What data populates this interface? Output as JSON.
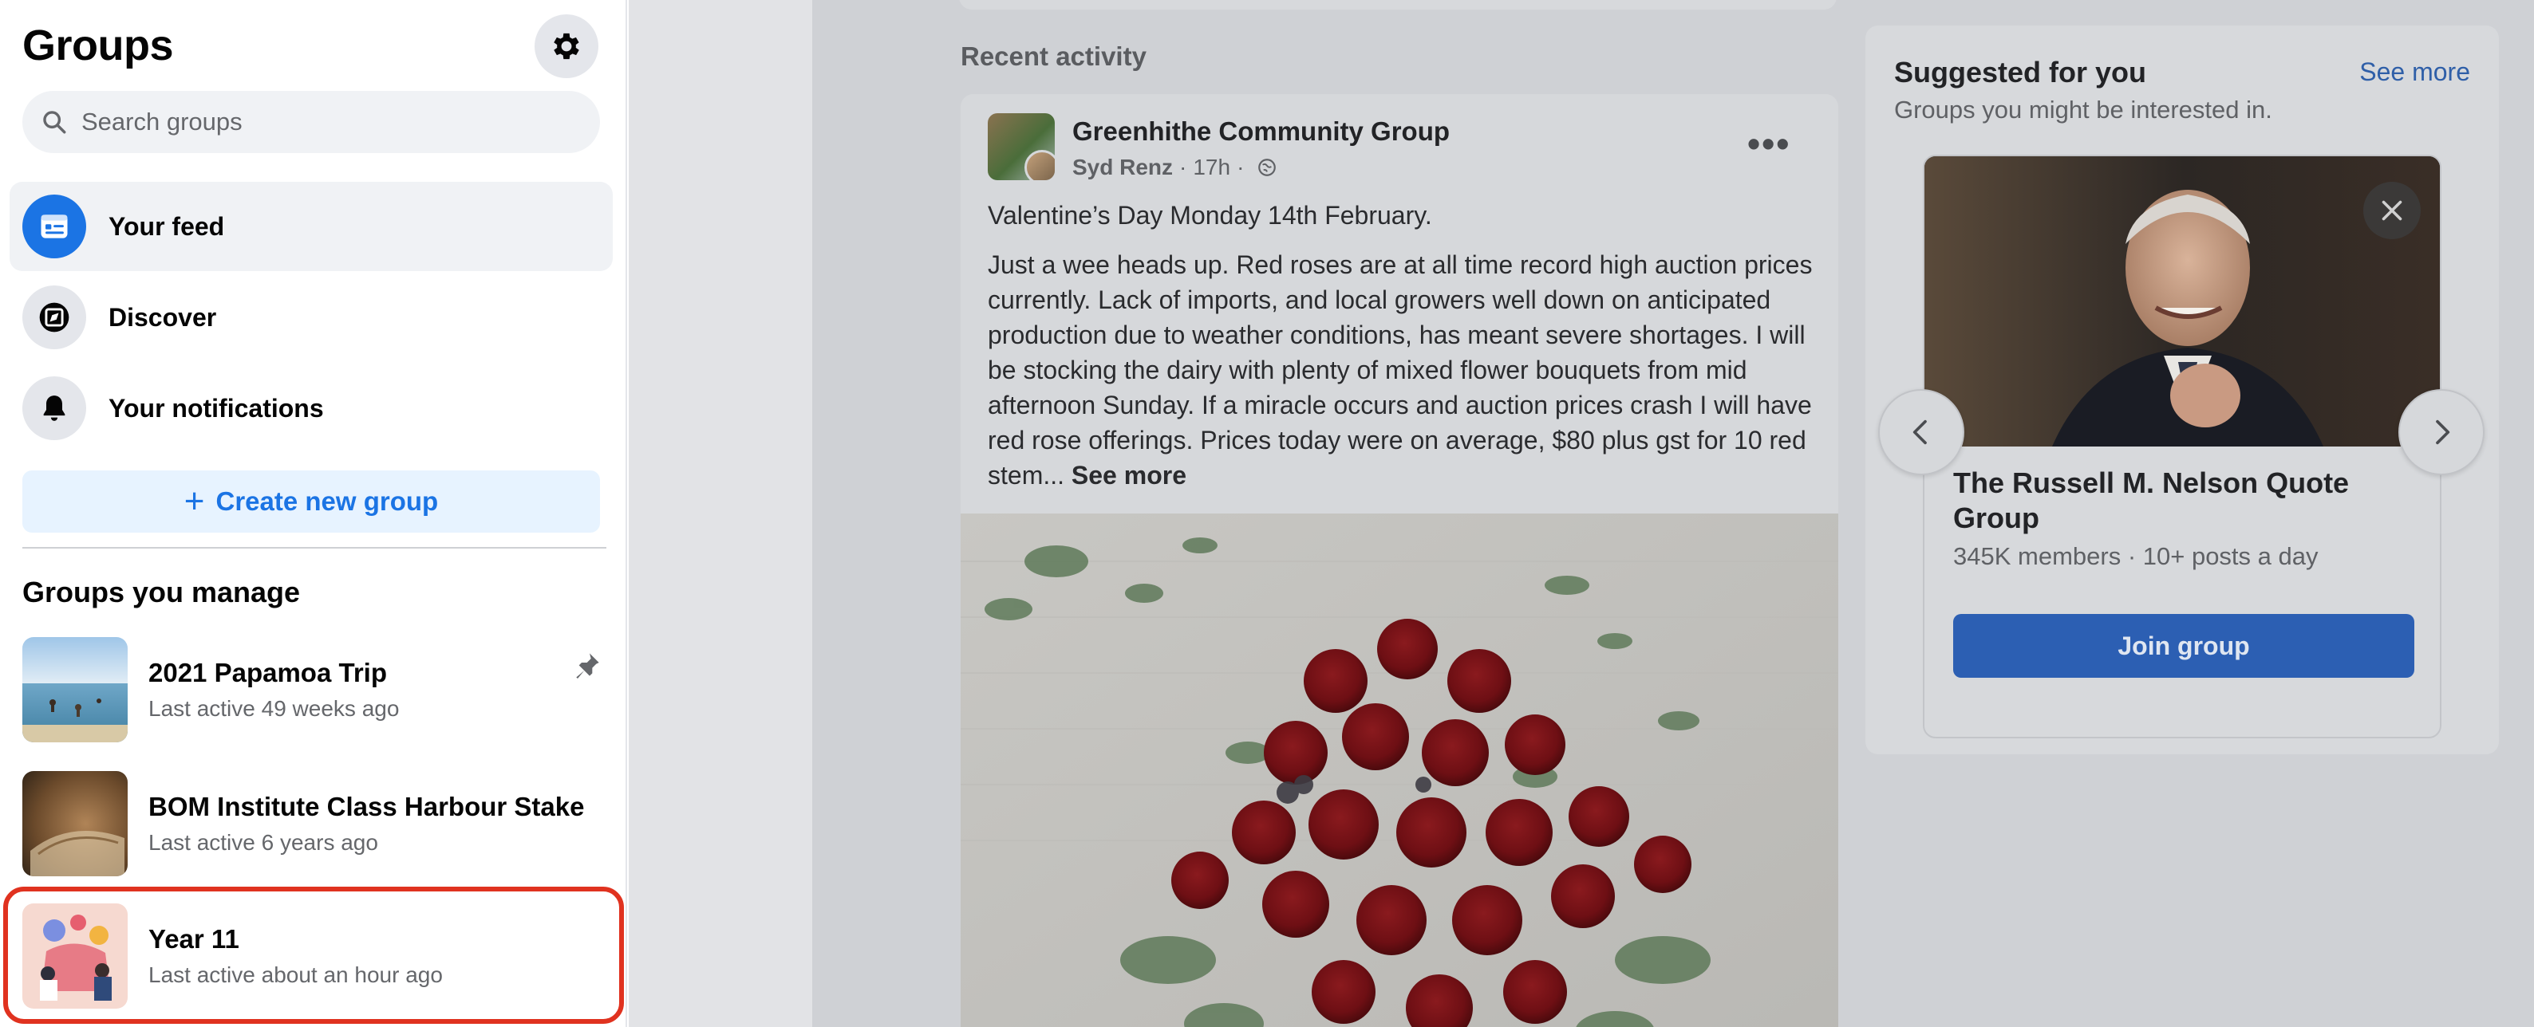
{
  "sidebar": {
    "title": "Groups",
    "search_placeholder": "Search groups",
    "nav": [
      {
        "label": "Your feed",
        "icon": "feed-icon",
        "active": true
      },
      {
        "label": "Discover",
        "icon": "compass-icon"
      },
      {
        "label": "Your notifications",
        "icon": "bell-icon"
      }
    ],
    "create_label": "Create new group",
    "manage_title": "Groups you manage",
    "groups": [
      {
        "name": "2021 Papamoa Trip",
        "meta": "Last active 49 weeks ago",
        "pinned": true
      },
      {
        "name": "BOM Institute Class Harbour Stake",
        "meta": "Last active 6 years ago"
      },
      {
        "name": "Year 11",
        "meta": "Last active about an hour ago",
        "highlighted": true
      }
    ]
  },
  "feed": {
    "section_title": "Recent activity",
    "post": {
      "group": "Greenhithe Community Group",
      "author": "Syd Renz",
      "time": "17h",
      "separator": "·",
      "headline": "Valentine’s Day Monday 14th February.",
      "body": "Just a wee heads up. Red roses are at all time record high auction prices currently. Lack of imports,  and local growers well down on anticipated production due to weather conditions, has meant severe shortages. I will be stocking the dairy with plenty of mixed flower bouquets from mid afternoon Sunday. If a miracle occurs and auction prices crash I will have red rose offerings. Prices today were on average, $80 plus gst for 10 red stem...",
      "see_more": "See more",
      "more_menu": "•••"
    }
  },
  "suggested": {
    "title": "Suggested for you",
    "see_more": "See more",
    "subtitle": "Groups you might be interested in.",
    "card": {
      "name": "The Russell M. Nelson Quote Group",
      "meta": "345K members · 10+ posts a day",
      "join_label": "Join group"
    }
  },
  "colors": {
    "accent": "#1b74e4",
    "highlight_border": "#e0321f",
    "join_button": "#2c5fb3"
  }
}
